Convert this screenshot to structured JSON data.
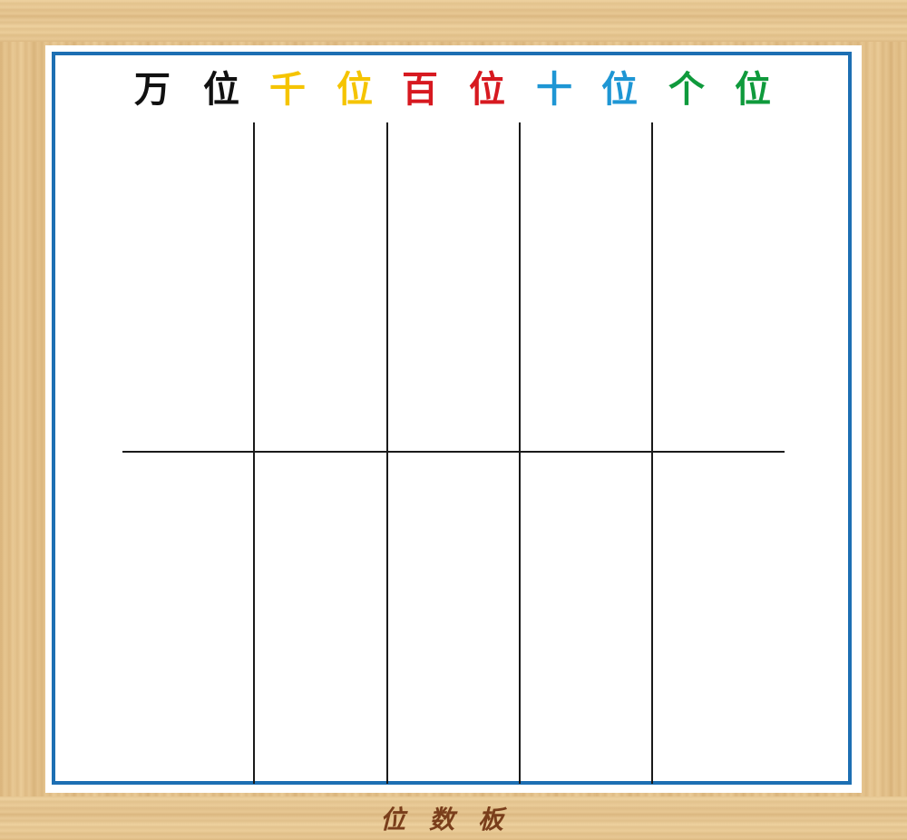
{
  "headers": [
    {
      "place": "万",
      "suffix": "位",
      "color": "#111111"
    },
    {
      "place": "千",
      "suffix": "位",
      "color": "#f5c400"
    },
    {
      "place": "百",
      "suffix": "位",
      "color": "#d71920"
    },
    {
      "place": "十",
      "suffix": "位",
      "color": "#1e96d4"
    },
    {
      "place": "个",
      "suffix": "位",
      "color": "#0f9a3c"
    }
  ],
  "title": "位数板",
  "colors": {
    "board_border": "#1d6fb3",
    "frame_wood": "#e6c58e",
    "grid_line": "#1a1a1a",
    "title_text": "#7a3e1b"
  }
}
